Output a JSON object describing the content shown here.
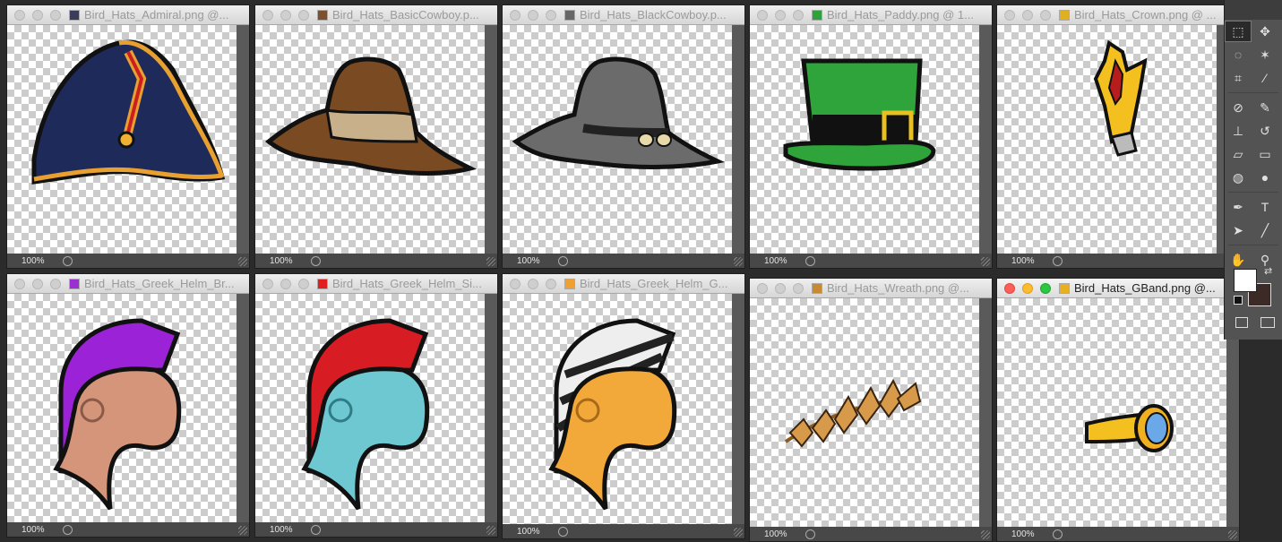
{
  "windows": [
    {
      "title": "Bird_Hats_Admiral.png @...",
      "zoom": "100%",
      "active": false,
      "icon_color": "#3b3b5b"
    },
    {
      "title": "Bird_Hats_BasicCowboy.p...",
      "zoom": "100%",
      "active": false,
      "icon_color": "#7a5030"
    },
    {
      "title": "Bird_Hats_BlackCowboy.p...",
      "zoom": "100%",
      "active": false,
      "icon_color": "#666666"
    },
    {
      "title": "Bird_Hats_Paddy.png @ 1...",
      "zoom": "100%",
      "active": false,
      "icon_color": "#2fa13a"
    },
    {
      "title": "Bird_Hats_Crown.png @ ...",
      "zoom": "100%",
      "active": false,
      "icon_color": "#e0b020"
    },
    {
      "title": "Bird_Hats_Greek_Helm_Br...",
      "zoom": "100%",
      "active": false,
      "icon_color": "#9b30d0"
    },
    {
      "title": "Bird_Hats_Greek_Helm_Si...",
      "zoom": "100%",
      "active": false,
      "icon_color": "#e02020"
    },
    {
      "title": "Bird_Hats_Greek_Helm_G...",
      "zoom": "100%",
      "active": false,
      "icon_color": "#f0a030"
    },
    {
      "title": "Bird_Hats_Wreath.png @...",
      "zoom": "100%",
      "active": false,
      "icon_color": "#c88a30"
    },
    {
      "title": "Bird_Hats_GBand.png @...",
      "zoom": "100%",
      "active": true,
      "icon_color": "#e8b020"
    }
  ],
  "tools": {
    "icons": [
      "rectangular-marquee-icon",
      "move-icon",
      "lasso-icon",
      "magic-wand-icon",
      "crop-icon",
      "eyedropper-icon",
      "spot-healing-icon",
      "brush-icon",
      "clone-stamp-icon",
      "history-brush-icon",
      "eraser-icon",
      "gradient-icon",
      "blur-icon",
      "dodge-icon",
      "pen-icon",
      "type-icon",
      "path-selection-icon",
      "line-icon",
      "hand-icon",
      "zoom-icon"
    ],
    "foreground_color": "#ffffff",
    "background_color": "#3b2a25"
  }
}
